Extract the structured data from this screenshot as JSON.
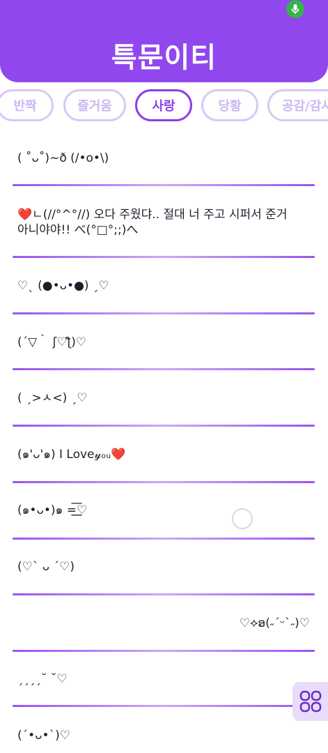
{
  "app": {
    "title": "특문이티"
  },
  "tabs": [
    {
      "label": "반짝",
      "active": false
    },
    {
      "label": "즐거움",
      "active": false
    },
    {
      "label": "사랑",
      "active": true
    },
    {
      "label": "당황",
      "active": false
    },
    {
      "label": "공감/감사",
      "active": false
    }
  ],
  "items": [
    "( ˚ᴗ˚)~ð (/•o•\\)",
    "❤️ㄴ(//°^°//) 오다 주웠댜.. 절대 너 주고 시퍼서 준거 아니야야!! べ(°□°;;)へ",
    "♡ˎ (●•ᴗ•●) ˏ♡",
    "(´▽｀ ʃ♡ƪ)♡",
    "( ˏ>ㅅ<) ˏ♡",
    "(๑'ᴗ'๑) I Love𝓎ₒᵤ❤️",
    "(๑•ᴗ•)๑ =͟͟͞♡",
    "(♡ˋ ᴗ ˊ♡)",
    "♡⟡ອ(˶ˊᵕˋ˶)♡",
    "ˏˏˏˏ˘ ˘♡",
    "(´•ᴗ•`)♡"
  ],
  "colors": {
    "accent": "#9147ee",
    "mic": "#38b24a"
  },
  "icons": {
    "mic": "mic-icon",
    "grid": "grid-icon"
  }
}
